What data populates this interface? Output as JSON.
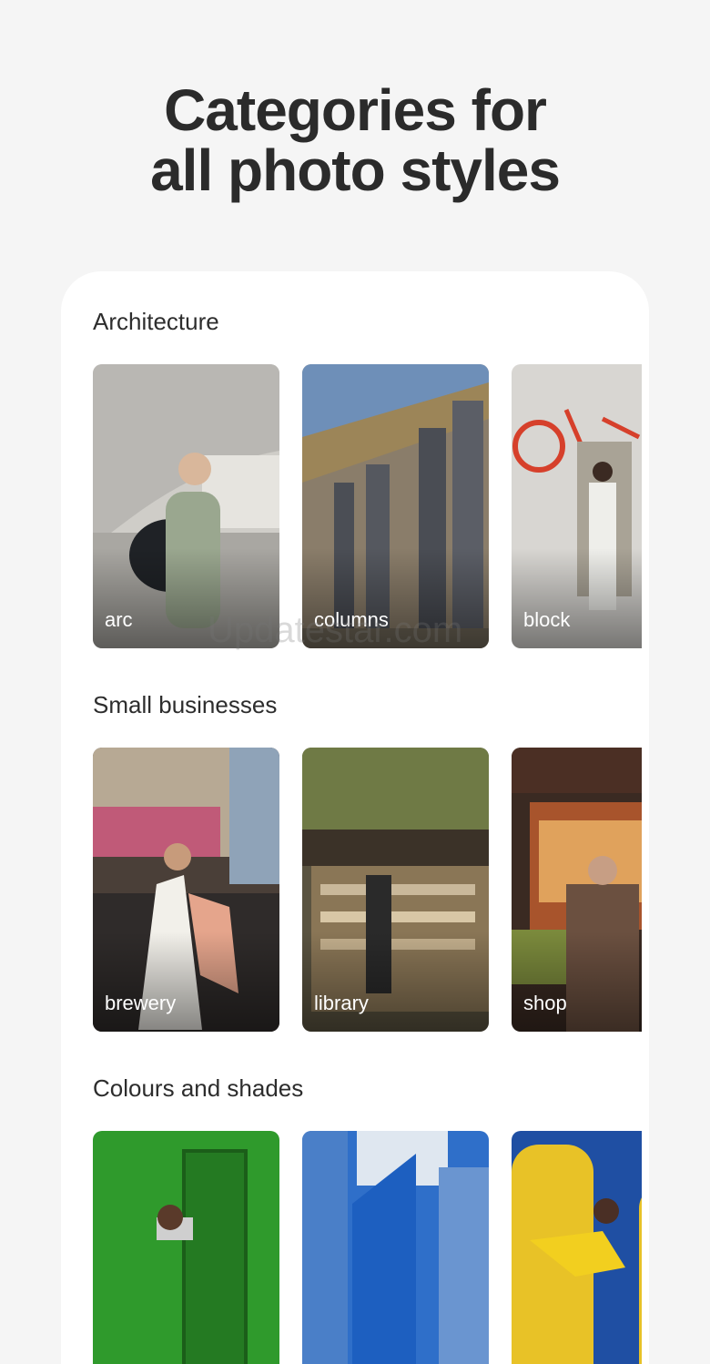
{
  "headline": {
    "line1": "Categories for",
    "line2": "all photo styles"
  },
  "sections": [
    {
      "title": "Architecture",
      "cards": [
        {
          "label": "arc"
        },
        {
          "label": "columns"
        },
        {
          "label": "block"
        }
      ]
    },
    {
      "title": "Small businesses",
      "cards": [
        {
          "label": "brewery"
        },
        {
          "label": "library"
        },
        {
          "label": "shop"
        }
      ]
    },
    {
      "title": "Colours and shades",
      "cards": [
        {
          "label": ""
        },
        {
          "label": ""
        },
        {
          "label": ""
        }
      ]
    }
  ],
  "watermark": "Updatestar.com"
}
